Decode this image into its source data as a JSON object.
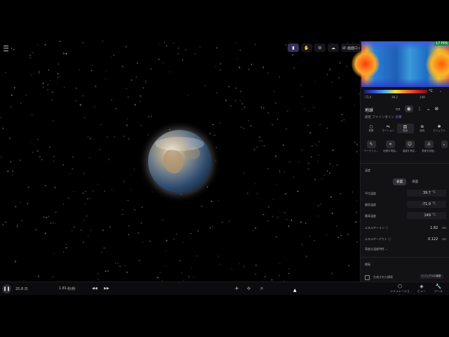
{
  "viewport": {
    "toolbar": {
      "items": [
        {
          "icon": "flashlight-icon",
          "glyph": "▮",
          "active": true
        },
        {
          "icon": "gesture-icon",
          "glyph": "✋"
        },
        {
          "icon": "settings-icon",
          "glyph": "⚙"
        },
        {
          "icon": "cloud-icon",
          "glyph": "☁"
        },
        {
          "icon": "lock-screen-icon",
          "glyph": "⊘",
          "label": "画面ロック"
        }
      ]
    }
  },
  "bottom_bar": {
    "pause_glyph": "❚❚",
    "day_label": "25.8 日",
    "time_scale": "1.81",
    "rate_label": "秒/秒",
    "rewind_glyph": "◀◀",
    "forward_glyph": "▶▶",
    "add_glyph": "+",
    "select_glyph": "⟡",
    "search_glyph": "⌕",
    "nav": [
      {
        "icon": "simulation-icon",
        "glyph": "⬡",
        "label": "シミュレーション"
      },
      {
        "icon": "view-icon",
        "glyph": "◈",
        "label": "ビュー"
      },
      {
        "icon": "tools-icon",
        "glyph": "🔧",
        "label": "ツール"
      }
    ]
  },
  "panel": {
    "fps": "17 FPS",
    "colorbar": {
      "unit": "°C",
      "min": "-71.0",
      "mid": "39.2",
      "max": "149",
      "chevron": "⌄"
    },
    "title": "地球",
    "header_icons": {
      "doc": "▭",
      "eye": "◉",
      "more": "⋮",
      "collapse": "⌄",
      "close": "⊗"
    },
    "subtitle_prefix": "惑星",
    "subtitle_mid": "ファインダイン",
    "subtitle_accent": "太陽",
    "tabs": [
      {
        "icon": "overview-icon",
        "glyph": "○",
        "label": "概要"
      },
      {
        "icon": "motion-icon",
        "glyph": "⇋",
        "label": "モーション"
      },
      {
        "icon": "surface-icon",
        "glyph": "▧",
        "label": "表面"
      },
      {
        "icon": "composition-icon",
        "glyph": "⊕",
        "label": "組成"
      },
      {
        "icon": "visual-icon",
        "glyph": "✱",
        "label": "ビジュアル"
      }
    ],
    "actions": [
      {
        "icon": "terraform-icon",
        "glyph": "✎",
        "label": "テーラフォ..."
      },
      {
        "icon": "texture-icon",
        "glyph": "⌗",
        "label": "地図を再描..."
      },
      {
        "icon": "temperature-icon",
        "glyph": "☺",
        "label": "温度を測定..."
      },
      {
        "icon": "place-icon",
        "glyph": "⚓",
        "label": "表面を回転..."
      },
      {
        "icon": "more-actions-icon",
        "glyph": "⌄",
        "label": ""
      }
    ],
    "temperature_section": "温度",
    "segments": [
      "表面",
      "海面"
    ],
    "fields": [
      {
        "label": "平均温度",
        "value": "39.7",
        "unit": "°C",
        "boxed": true
      },
      {
        "label": "最低温度",
        "value": "-71.0",
        "unit": "°C",
        "boxed": true
      },
      {
        "label": "最高温度",
        "value": "149",
        "unit": "°C",
        "boxed": true
      },
      {
        "label": "エネルギーイン ⓘ",
        "value": "1.82",
        "unit": "nn",
        "boxed": false
      },
      {
        "label": "エネルギーアウト ⓘ",
        "value": "0.122",
        "unit": "nn",
        "boxed": false
      }
    ],
    "advanced_label": "高度な温度特性 ⌄",
    "map_section": "標高",
    "generated_label": "生成された標高",
    "visual_button": "ビジュアルの編集"
  }
}
